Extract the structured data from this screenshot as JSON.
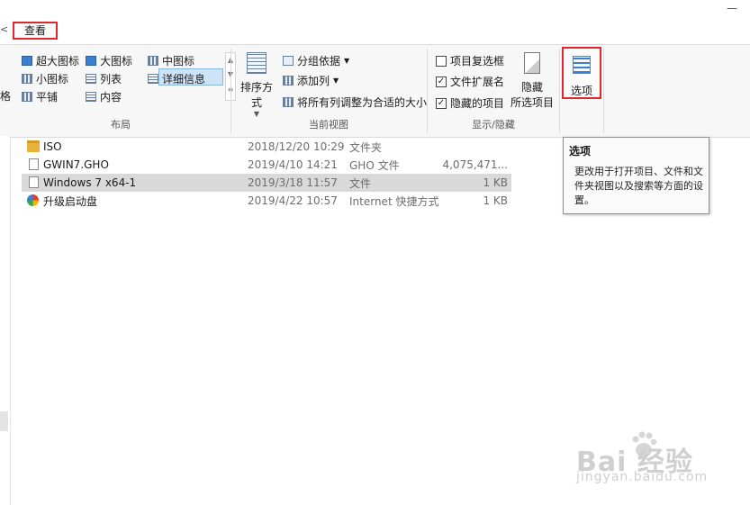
{
  "top": {
    "left_edge_mark": "<",
    "view_tab": "查看",
    "minimize": "—"
  },
  "ribbon": {
    "left_edge_label": "格",
    "layout": {
      "group_label": "布局",
      "items": [
        "超大图标",
        "大图标",
        "中图标",
        "小图标",
        "列表",
        "详细信息",
        "平铺",
        "内容"
      ]
    },
    "current_view": {
      "group_label": "当前视图",
      "sort_label": "排序方式",
      "group_by": "分组依据",
      "add_column": "添加列",
      "fit_columns": "将所有列调整为合适的大小"
    },
    "show_hide": {
      "group_label": "显示/隐藏",
      "item_checkboxes": "项目复选框",
      "file_extensions": "文件扩展名",
      "hidden_items": "隐藏的项目",
      "hide_selected_line1": "隐藏",
      "hide_selected_line2": "所选项目"
    },
    "options": {
      "label": "选项"
    }
  },
  "files": [
    {
      "name": "ISO",
      "date": "2018/12/20 10:29",
      "type": "文件夹",
      "size": ""
    },
    {
      "name": "GWIN7.GHO",
      "date": "2019/4/10 14:21",
      "type": "GHO 文件",
      "size": "4,075,471..."
    },
    {
      "name": "Windows 7 x64-1",
      "date": "2019/3/18 11:57",
      "type": "文件",
      "size": "1 KB"
    },
    {
      "name": "升级启动盘",
      "date": "2019/4/22 10:57",
      "type": "Internet 快捷方式",
      "size": "1 KB"
    }
  ],
  "tooltip": {
    "title": "选项",
    "text": "更改用于打开项目、文件和文件夹视图以及搜索等方面的设置。"
  },
  "watermark": {
    "logo": "Bai 经验",
    "url": "jingyan.baidu.com"
  },
  "icons": {
    "folder": "folder-icon",
    "file": "file-icon",
    "internet_shortcut": "internet-shortcut-icon"
  }
}
